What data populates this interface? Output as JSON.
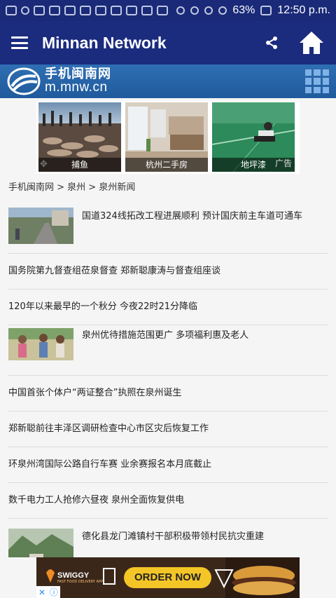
{
  "statusbar": {
    "battery": "63%",
    "time": "12:50 p.m."
  },
  "appbar": {
    "title": "Minnan Network",
    "icons": [
      "menu-icon",
      "share-icon",
      "home-icon"
    ]
  },
  "site_header": {
    "logo_cn": "手机闽南网",
    "logo_url": "m.mnw.cn",
    "icons": [
      "grid-icon"
    ]
  },
  "ad_strip": {
    "cards": [
      {
        "caption": "捕鱼"
      },
      {
        "caption": "杭州二手房"
      },
      {
        "caption": "地坪漆"
      }
    ],
    "tag": "广告"
  },
  "breadcrumb": "手机闽南网 > 泉州 > 泉州新闻",
  "news": [
    {
      "title": "国道324线拓改工程进展顺利 预计国庆前主车道可通车",
      "thumb": true
    },
    {
      "title": "国务院第九督查组莅泉督查 郑新聪康涛与督查组座谈",
      "thumb": false
    },
    {
      "title": "120年以来最早的一个秋分 今夜22时21分降临",
      "thumb": false
    },
    {
      "title": "泉州优待措施范围更广 多项福利惠及老人",
      "thumb": true
    },
    {
      "title": "中国首张个体户“两证整合”执照在泉州诞生",
      "thumb": false
    },
    {
      "title": "郑新聪前往丰泽区调研检查中心市区灾后恢复工作",
      "thumb": false
    },
    {
      "title": "环泉州湾国际公路自行车赛 业余赛报名本月底截止",
      "thumb": false
    },
    {
      "title": "数千电力工人抢修六昼夜 泉州全面恢复供电",
      "thumb": false
    },
    {
      "title": "德化县龙门滩镇村干部积极带领村民抗灾重建",
      "thumb": true
    }
  ],
  "bottom_ad": {
    "brand": "SWIGGY",
    "tagline": "FAST FOOD DELIVERY APP",
    "button": "ORDER NOW"
  }
}
